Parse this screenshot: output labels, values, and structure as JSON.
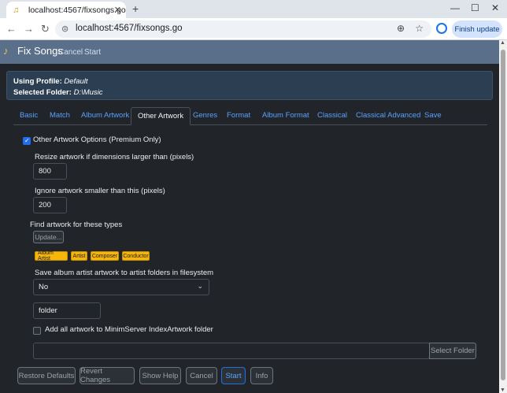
{
  "browser": {
    "tab_title": "localhost:4567/fixsongs.go",
    "url": "localhost:4567/fixsongs.go",
    "update_label": "Finish update"
  },
  "app": {
    "brand": "Fix Songs",
    "nav": {
      "cancel": "Cancel",
      "start": "Start"
    },
    "profile": {
      "profile_label": "Using Profile:",
      "profile_value": "Default",
      "folder_label": "Selected Folder:",
      "folder_value": "D:\\Music"
    },
    "tabs": [
      "Basic",
      "Match",
      "Album Artwork",
      "Other Artwork",
      "Genres",
      "Format",
      "Album Format",
      "Classical",
      "Classical Advanced",
      "Save"
    ],
    "active_tab": "Other Artwork",
    "form": {
      "options_label": "Other Artwork Options (Premium Only)",
      "options_checked": true,
      "resize_label": "Resize artwork if dimensions larger than (pixels)",
      "resize_value": "800",
      "ignore_label": "Ignore artwork smaller than this (pixels)",
      "ignore_value": "200",
      "find_label": "Find artwork for these types",
      "update_button": "Update...",
      "types": [
        "Album Artist",
        "Artist",
        "Composer",
        "Conductor"
      ],
      "save_label": "Save album artist artwork to artist folders in filesystem",
      "save_value": "No",
      "folder_value": "folder",
      "minim_label": "Add all artwork to MinimServer IndexArtwork folder",
      "minim_checked": false,
      "folder_path_value": "",
      "select_folder_button": "Select Folder"
    },
    "buttons": {
      "restore": "Restore Defaults",
      "revert": "Revert Changes",
      "help": "Show Help",
      "cancel": "Cancel",
      "start": "Start",
      "info": "Info"
    }
  },
  "colors": {
    "background": "#212529",
    "navbar": "#5a6f8a",
    "link": "#5aa0ff",
    "badge": "#f5b50a",
    "primary": "#1f6feb"
  }
}
